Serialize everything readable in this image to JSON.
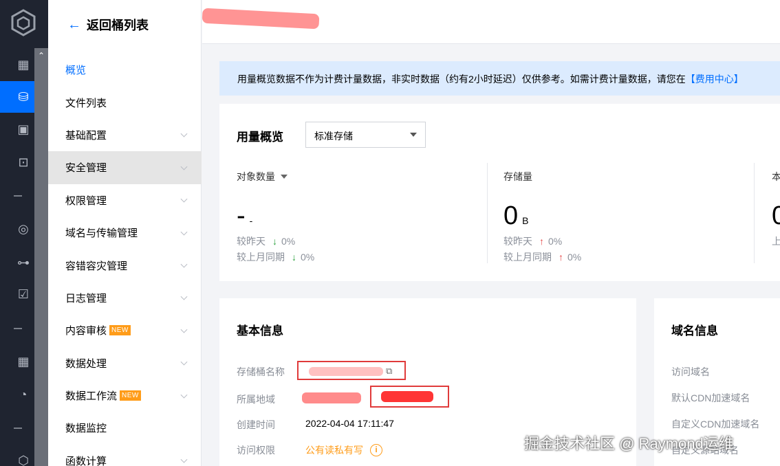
{
  "back": {
    "label": "返回桶列表"
  },
  "sidebar": {
    "items": [
      {
        "label": "概览",
        "active": true,
        "expandable": false
      },
      {
        "label": "文件列表",
        "expandable": false
      },
      {
        "label": "基础配置",
        "expandable": true
      },
      {
        "label": "安全管理",
        "expandable": true,
        "highlighted": true
      },
      {
        "label": "权限管理",
        "expandable": true
      },
      {
        "label": "域名与传输管理",
        "expandable": true
      },
      {
        "label": "容错容灾管理",
        "expandable": true
      },
      {
        "label": "日志管理",
        "expandable": true
      },
      {
        "label": "内容审核",
        "badge": "NEW",
        "expandable": true
      },
      {
        "label": "数据处理",
        "expandable": true
      },
      {
        "label": "数据工作流",
        "badge": "NEW",
        "expandable": true
      },
      {
        "label": "数据监控",
        "expandable": false
      },
      {
        "label": "函数计算",
        "expandable": true
      }
    ]
  },
  "notice": {
    "text": "用量概览数据不作为计费计量数据，非实时数据（约有2小时延迟）仅供参考。如需计费计量数据，请您在",
    "link": "【费用中心】"
  },
  "usage": {
    "title": "用量概览",
    "storage_class": "标准存储",
    "stats": [
      {
        "label": "对象数量",
        "has_dropdown": true,
        "value": "-",
        "unit": "-",
        "vs_yesterday_label": "较昨天",
        "vs_yesterday": "0%",
        "vs_yesterday_dir": "down",
        "vs_lastmonth_label": "较上月同期",
        "vs_lastmonth": "0%",
        "vs_lastmonth_dir": "down"
      },
      {
        "label": "存储量",
        "has_dropdown": false,
        "value": "0",
        "unit": "B",
        "vs_yesterday_label": "较昨天",
        "vs_yesterday": "0%",
        "vs_yesterday_dir": "up",
        "vs_lastmonth_label": "较上月同期",
        "vs_lastmonth": "0%",
        "vs_lastmonth_dir": "up"
      },
      {
        "label": "本",
        "value": "0",
        "vs_yesterday_label": "上"
      }
    ]
  },
  "basic_info": {
    "title": "基本信息",
    "bucket_name_label": "存储桶名称",
    "region_label": "所属地域",
    "created_label": "创建时间",
    "created_value": "2022-04-04 17:11:47",
    "access_label": "访问权限",
    "access_value": "公有读私有写"
  },
  "domain_info": {
    "title": "域名信息",
    "rows": [
      "访问域名",
      "默认CDN加速域名",
      "自定义CDN加速域名",
      "自定义源站域名"
    ]
  },
  "watermark": "掘金技术社区 @ Raymond运维",
  "colors": {
    "accent": "#006eff",
    "rail": "#1f2430",
    "notice_bg": "#dcebfe",
    "orange": "#ff9c19",
    "up": "#e54545",
    "down": "#29a13b"
  }
}
